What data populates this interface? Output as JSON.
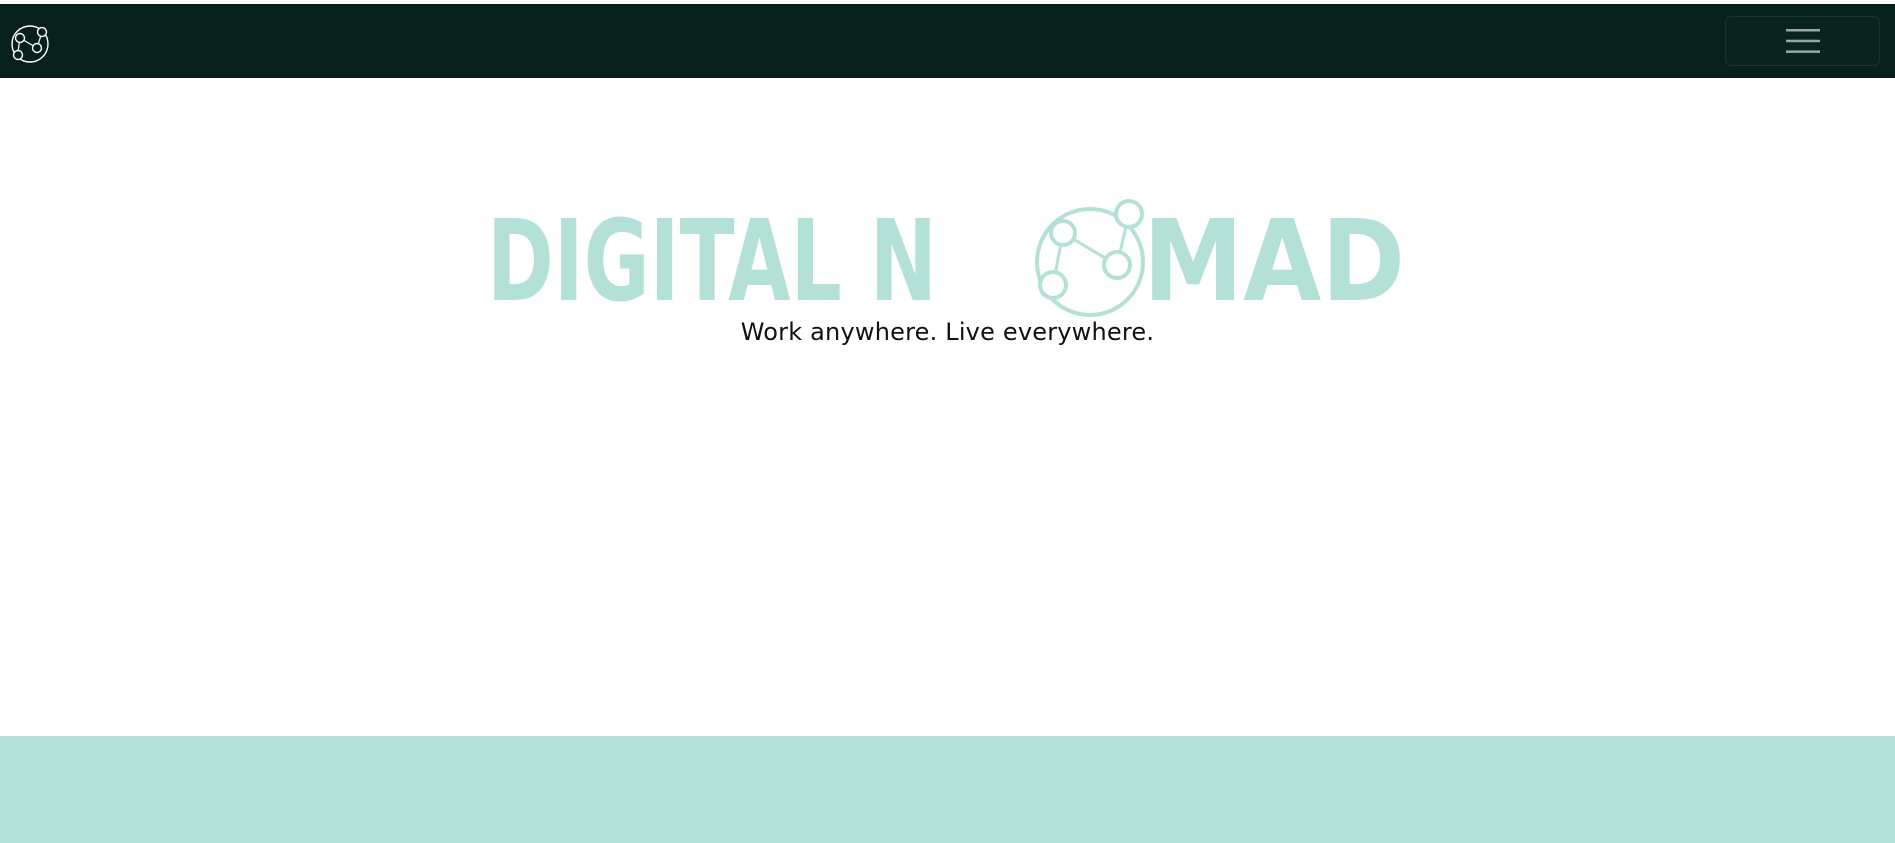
{
  "colors": {
    "navbar_bg": "#07201b",
    "brand_accent": "#b3e1d8",
    "tagline_text": "#111111",
    "page_bg": "#ffffff"
  },
  "navbar": {
    "logo_icon": "network-globe-icon",
    "menu_icon": "hamburger-menu-icon"
  },
  "hero": {
    "title_left": "DIGITAL N",
    "title_right": "MAD",
    "title_o_icon": "network-globe-icon",
    "tagline": "Work anywhere. Live everywhere."
  }
}
